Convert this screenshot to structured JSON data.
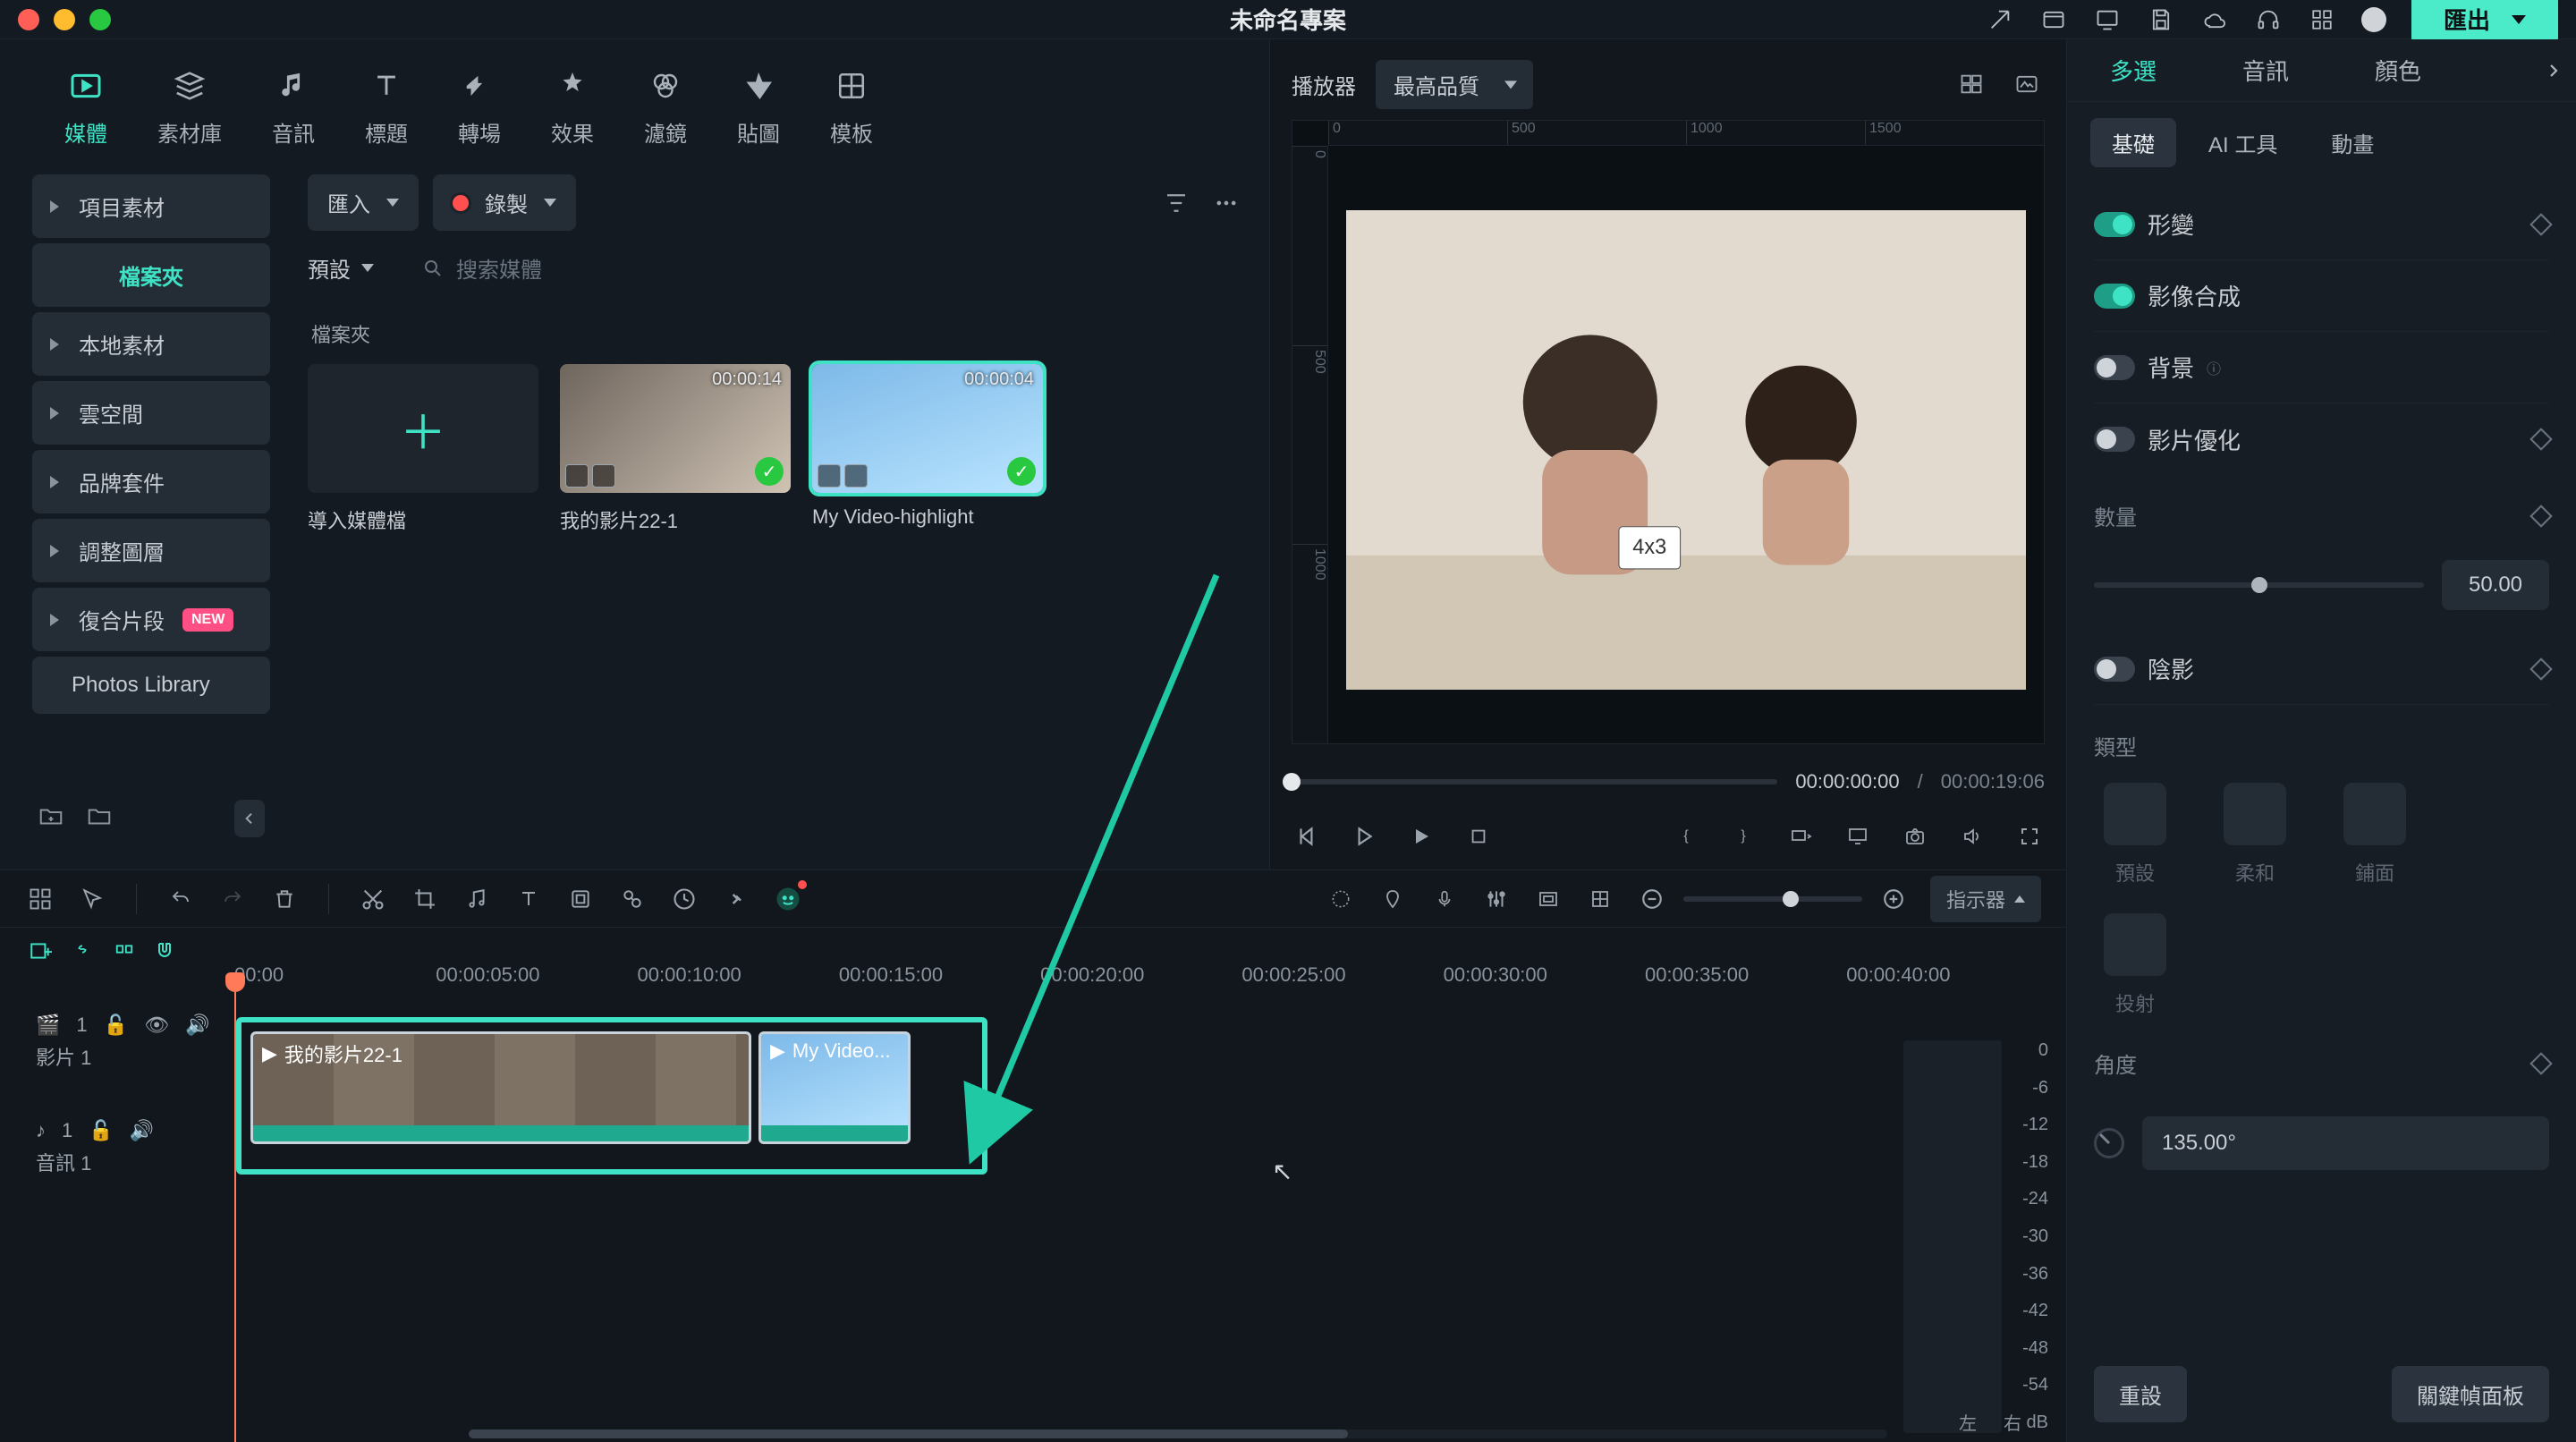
{
  "title": "未命名專案",
  "export_label": "匯出",
  "ribbon": [
    {
      "id": "media",
      "label": "媒體",
      "active": true
    },
    {
      "id": "stock",
      "label": "素材庫"
    },
    {
      "id": "audio",
      "label": "音訊"
    },
    {
      "id": "titles",
      "label": "標題"
    },
    {
      "id": "transitions",
      "label": "轉場"
    },
    {
      "id": "effects",
      "label": "效果"
    },
    {
      "id": "filters",
      "label": "濾鏡"
    },
    {
      "id": "stickers",
      "label": "貼圖"
    },
    {
      "id": "templates",
      "label": "模板"
    }
  ],
  "lib_sidebar": {
    "project_assets": "項目素材",
    "folders": "檔案夾",
    "local": "本地素材",
    "cloud": "雲空間",
    "brand": "品牌套件",
    "adjust": "調整圖層",
    "compound": "復合片段",
    "compound_badge": "NEW",
    "photos": "Photos Library"
  },
  "lib_toolbar": {
    "import": "匯入",
    "record": "錄製",
    "sort": "預設",
    "search_placeholder": "搜索媒體",
    "folders_heading": "檔案夾"
  },
  "cards": {
    "import": "導入媒體檔",
    "c1": {
      "name": "我的影片22-1",
      "dur": "00:00:14"
    },
    "c2": {
      "name": "My Video-highlight",
      "dur": "00:00:04"
    }
  },
  "preview": {
    "label": "播放器",
    "quality": "最高品質",
    "ruler_h": [
      "0",
      "500",
      "1000",
      "1500"
    ],
    "ruler_v": [
      "0",
      "500",
      "1000"
    ],
    "cur": "00:00:00:00",
    "sep": "/",
    "dur": "00:00:19:06"
  },
  "timeline": {
    "indicator": "指示器",
    "ticks": [
      "00:00",
      "00:00:05:00",
      "00:00:10:00",
      "00:00:15:00",
      "00:00:20:00",
      "00:00:25:00",
      "00:00:30:00",
      "00:00:35:00",
      "00:00:40:00"
    ],
    "track_video_icon": "🎬",
    "track_video_num": "1",
    "track_video": "影片 1",
    "track_audio_icon": "♪",
    "track_audio_num": "1",
    "track_audio": "音訊 1",
    "clip1": "我的影片22-1",
    "clip2": "My Video...",
    "meter_db": [
      "0",
      "-6",
      "-12",
      "-18",
      "-24",
      "-30",
      "-36",
      "-42",
      "-48",
      "-54"
    ],
    "meter_unit": "dB",
    "meter_l": "左",
    "meter_r": "右"
  },
  "props": {
    "tabs": {
      "multi": "多選",
      "audio": "音訊",
      "color": "顏色"
    },
    "subtabs": {
      "basic": "基礎",
      "ai": "AI 工具",
      "anim": "動畫"
    },
    "transform": "形變",
    "compose": "影像合成",
    "background": "背景",
    "optimize": "影片優化",
    "count": "數量",
    "count_value": "50.00",
    "shadow": "陰影",
    "type": "類型",
    "type_default": "預設",
    "type_soft": "柔和",
    "type_fill": "鋪面",
    "type_cast": "投射",
    "angle": "角度",
    "angle_value": "135.00°",
    "reset": "重設",
    "keyframe": "關鍵幀面板"
  }
}
